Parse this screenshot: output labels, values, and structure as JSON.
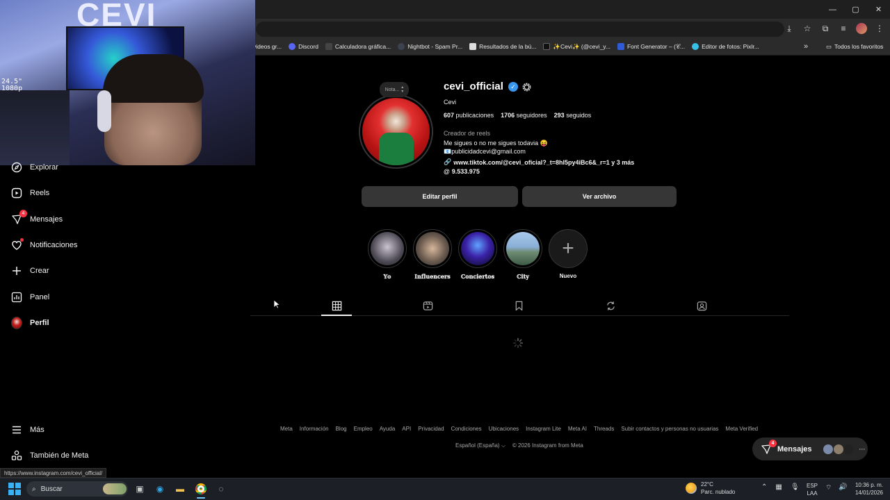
{
  "browser": {
    "window_controls": [
      "—",
      "▢",
      "✕"
    ],
    "bookmarks": [
      {
        "label": "videos gr...",
        "icon": "folder-icon"
      },
      {
        "label": "Discord",
        "icon": "discord-icon"
      },
      {
        "label": "Calculadora gráfica...",
        "icon": "desmos-icon"
      },
      {
        "label": "Nightbot - Spam Pr...",
        "icon": "nightbot-icon"
      },
      {
        "label": "Resultados de la bú...",
        "icon": "doc-icon"
      },
      {
        "label": "✨Cevi✨ (@cevi_y...",
        "icon": "tiktok-icon"
      },
      {
        "label": "Font Generator – (𝒞...",
        "icon": "font-icon"
      },
      {
        "label": "Editor de fotos: Pixlr...",
        "icon": "pixlr-icon"
      }
    ],
    "bookmarks_more": "»",
    "all_favorites": "Todos los favoritos",
    "status_url": "https://www.instagram.com/cevi_official/"
  },
  "webcam": {
    "logo": "CEVI",
    "overlay_text": "24.5\"\n1080p"
  },
  "nav": {
    "items": [
      {
        "label": "Explorar",
        "icon": "compass-icon"
      },
      {
        "label": "Reels",
        "icon": "reels-icon"
      },
      {
        "label": "Mensajes",
        "icon": "messenger-icon",
        "badge": "4"
      },
      {
        "label": "Notificaciones",
        "icon": "heart-icon"
      },
      {
        "label": "Crear",
        "icon": "plus-icon"
      },
      {
        "label": "Panel",
        "icon": "chart-icon"
      },
      {
        "label": "Perfil",
        "icon": "avatar"
      }
    ],
    "more": "Más",
    "also_meta": "También de Meta"
  },
  "profile": {
    "note_placeholder": "Nota...",
    "username": "cevi_official",
    "verified_mark": "✓",
    "full_name": "Cevi",
    "posts_count": "607",
    "posts_label": "publicaciones",
    "followers_count": "1706",
    "followers_label": "seguidores",
    "following_count": "293",
    "following_label": "seguidos",
    "category": "Creador de reels",
    "bio_line1": "Me sigues o no me sigues todavia 😝",
    "bio_line2": "📧publicidadcevi@gmail.com",
    "bio_link": "www.tiktok.com/@cevi_oficial?_t=8hI5py4iBc6&_r=1 y 3 más",
    "threads": "9.533.975",
    "edit_button": "Editar perfil",
    "archive_button": "Ver archivo"
  },
  "highlights": [
    {
      "label": "𝕐𝕠"
    },
    {
      "label": "𝕀𝕟𝕗𝕝𝕦𝕖𝕟𝕔𝕖𝕣𝕤"
    },
    {
      "label": "ℂ𝕠𝕟𝕔𝕚𝕖𝕣𝕥𝕠𝕤"
    },
    {
      "label": "ℂ𝕚𝕥𝕪"
    },
    {
      "label": "Nuevo"
    }
  ],
  "tabs": [
    "posts-grid-icon",
    "reels-tab-icon",
    "saved-icon",
    "reposts-icon",
    "tagged-icon"
  ],
  "footer": {
    "links": [
      "Meta",
      "Información",
      "Blog",
      "Empleo",
      "Ayuda",
      "API",
      "Privacidad",
      "Condiciones",
      "Ubicaciones",
      "Instagram Lite",
      "Meta AI",
      "Threads",
      "Subir contactos y personas no usuarias",
      "Meta Verified"
    ],
    "language": "Español (España) ⌵",
    "copyright": "© 2026 Instagram from Meta"
  },
  "messages_pill": {
    "label": "Mensajes",
    "badge": "4",
    "more": "···"
  },
  "taskbar": {
    "search_label": "Buscar",
    "weather_temp": "22°C",
    "weather_desc": "Parc. nublado",
    "lang_top": "ESP",
    "lang_bottom": "LAA",
    "time": "10:36 p. m.",
    "date": "14/01/2026"
  },
  "colors": {
    "background": "#000000",
    "surface": "#363636",
    "verified": "#3897f0",
    "badge": "#ff3040",
    "text_muted": "#a8a8a8"
  }
}
